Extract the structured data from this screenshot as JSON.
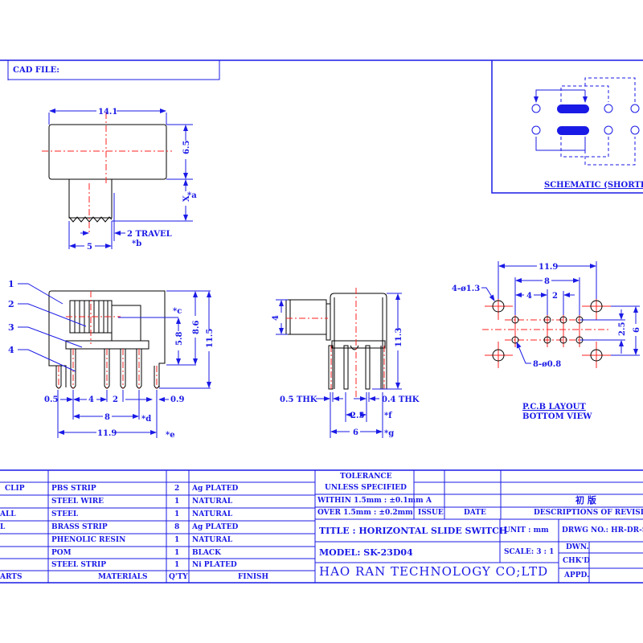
{
  "header": {
    "cad_file_label": "CAD FILE:",
    "cad_file_value": ""
  },
  "schematic": {
    "title": "SCHEMATIC (SHORTING)"
  },
  "top_view": {
    "width_dim": "14.1",
    "height_dim": "6.5",
    "actuator_dim": "X",
    "actuator_note": "*a",
    "actuator_width_dim": "5",
    "travel_label": "2 TRAVEL",
    "travel_note": "*b"
  },
  "front_view": {
    "callouts": [
      "1",
      "2",
      "3",
      "4"
    ],
    "dims": {
      "h1": "5.8",
      "h2": "8.6",
      "h3": "11.5",
      "note_c": "*c",
      "pin_width": "0.5",
      "pitch1": "4",
      "pitch2": "2",
      "edge": "0.9",
      "span8": "8",
      "note_d": "*d",
      "span_total": "11.9",
      "note_e": "*e"
    }
  },
  "side_view": {
    "dims": {
      "actuator_h": "4",
      "height": "11.3",
      "thk_left": "0.5 THK",
      "thk_right": "0.4 THK",
      "pitch": "2.5",
      "note_f": "*f",
      "width": "6",
      "note_g": "*g"
    }
  },
  "pcb_layout": {
    "dims": {
      "span_total": "11.9",
      "span8": "8",
      "pitch4": "4",
      "pitch2": "2",
      "row_pitch": "2.5",
      "mount_pitch": "6",
      "mount_holes": "4-ø1.3",
      "pin_holes": "8-ø0.8"
    },
    "title_line1": "P.C.B LAYOUT",
    "title_line2": "BOTTOM VIEW"
  },
  "bom": {
    "headers": {
      "parts": "ARTS",
      "materials": "MATERIALS",
      "qty": "Q'TY",
      "finish": "FINISH"
    },
    "rows": [
      {
        "part": "CLIP",
        "material": "PBS STRIP",
        "qty": "2",
        "finish": "Ag PLATED"
      },
      {
        "part": "",
        "material": "STEEL WIRE",
        "qty": "1",
        "finish": "NATURAL"
      },
      {
        "part": "ALL",
        "material": "STEEL",
        "qty": "1",
        "finish": "NATURAL"
      },
      {
        "part": "L",
        "material": "BRASS STRIP",
        "qty": "8",
        "finish": "Ag PLATED"
      },
      {
        "part": "",
        "material": "PHENOLIC RESIN",
        "qty": "1",
        "finish": "NATURAL"
      },
      {
        "part": "",
        "material": "POM",
        "qty": "1",
        "finish": "BLACK"
      },
      {
        "part": "",
        "material": "STEEL STRIP",
        "qty": "1",
        "finish": "Ni PLATED"
      }
    ]
  },
  "title_block": {
    "tolerance_title": "TOLERANCE",
    "tolerance_sub": "UNLESS  SPECIFIED",
    "tol_within": "WITHIN 1.5mm : ±0.1mm",
    "tol_over": "OVER  1.5mm : ±0.2mm",
    "issue_value": "A",
    "issue_label": "ISSUE",
    "date_label": "DATE",
    "revision_value": "初 版",
    "revision_label": "DESCRIPTIONS OF REVISION",
    "title": "TITLE :  HORIZONTAL SLIDE SWITCH",
    "unit": "UNIT :  mm",
    "drwg_no": "DRWG NO.:  HR-DR-S",
    "model": "MODEL:  SK-23D04",
    "scale": "SCALE: 3 : 1",
    "dwn": "DWN.",
    "chkd": "CHK'D",
    "appd": "APPD.",
    "company": "HAO RAN TECHNOLOGY CO;LTD"
  }
}
